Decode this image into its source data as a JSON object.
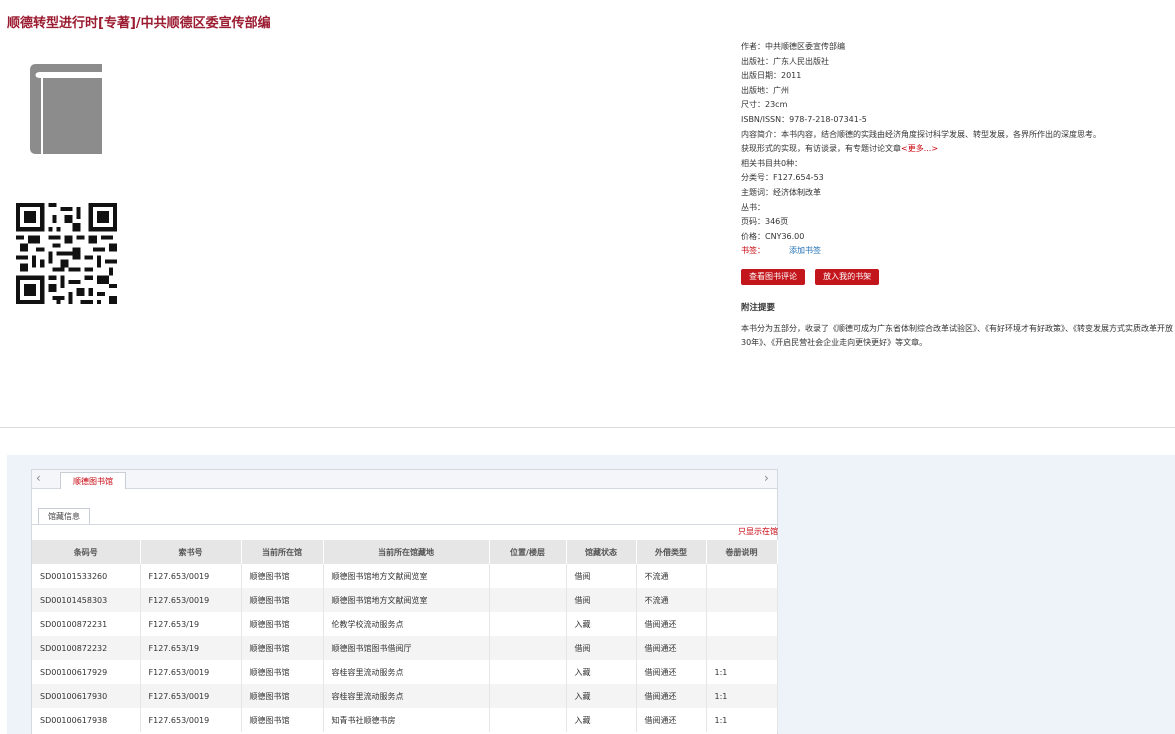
{
  "book": {
    "title": "顺德转型进行时[专著]/中共顺德区委宣传部编",
    "info": {
      "author": "作者：中共顺德区委宣传部编",
      "publisher": "出版社：广东人民出版社",
      "pub_date": "出版日期：2011",
      "pub_place": "出版地：广州",
      "size": "尺寸：23cm",
      "isbn": "ISBN/ISSN：978-7-218-07341-5",
      "summary": "内容简介：本书内容，结合顺德的实践由经济角度探讨科学发展、转型发展，各界所作出的深度思考。",
      "summary2": "获现形式的实现，有访谈录，有专题讨论文章",
      "more": "<更多...>",
      "related": "相关书目共0种：",
      "class_no": "分类号：F127.654-53",
      "subject": "主题词：经济体制改革",
      "series": "丛书：",
      "pages": "页码：346页",
      "price": "价格：CNY36.00",
      "shelf_label": "书签：",
      "add_bookmark": "添加书签"
    },
    "buttons": {
      "view_reviews": "查看图书评论",
      "add_to_shelf": "放入我的书架"
    },
    "note_title": "附注提要",
    "note_text": "本书分为五部分，收录了《顺德可成为广东省体制综合改革试验区》、《有好环境才有好政策》、《转变发展方式实质改革开放30年》、《开启民营社会企业走向更快更好》等文章。"
  },
  "holdings": {
    "library_tab": "顺德图书馆",
    "subtab": "馆藏信息",
    "show_location": "只显示在馆",
    "columns": [
      "条码号",
      "索书号",
      "当前所在馆",
      "当前所在馆藏地",
      "位置/楼层",
      "馆藏状态",
      "外借类型",
      "卷册说明"
    ],
    "rows": [
      [
        "SD00101533260",
        "F127.653/0019",
        "顺德图书馆",
        "顺德图书馆地方文献阅览室",
        "",
        "借阅",
        "不流通",
        ""
      ],
      [
        "SD00101458303",
        "F127.653/0019",
        "顺德图书馆",
        "顺德图书馆地方文献阅览室",
        "",
        "借阅",
        "不流通",
        ""
      ],
      [
        "SD00100872231",
        "F127.653/19",
        "顺德图书馆",
        "伦教学校流动服务点",
        "",
        "入藏",
        "借阅通还",
        ""
      ],
      [
        "SD00100872232",
        "F127.653/19",
        "顺德图书馆",
        "顺德图书馆图书借阅厅",
        "",
        "借阅",
        "借阅通还",
        ""
      ],
      [
        "SD00100617929",
        "F127.653/0019",
        "顺德图书馆",
        "容桂容里流动服务点",
        "",
        "入藏",
        "借阅通还",
        "1:1"
      ],
      [
        "SD00100617930",
        "F127.653/0019",
        "顺德图书馆",
        "容桂容里流动服务点",
        "",
        "入藏",
        "借阅通还",
        "1:1"
      ],
      [
        "SD00100617938",
        "F127.653/0019",
        "顺德图书馆",
        "知青书社顺德书房",
        "",
        "入藏",
        "借阅通还",
        "1:1"
      ]
    ]
  },
  "icons": {
    "book": "book-icon",
    "qr": "qr-code",
    "left": "chevron-left-icon",
    "right": "chevron-right-icon"
  }
}
